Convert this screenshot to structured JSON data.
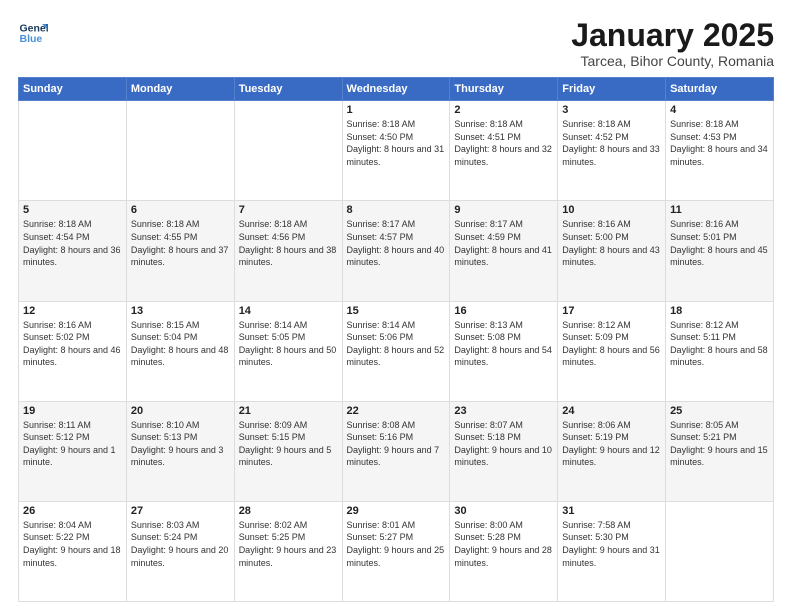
{
  "header": {
    "logo_line1": "General",
    "logo_line2": "Blue",
    "title": "January 2025",
    "subtitle": "Tarcea, Bihor County, Romania"
  },
  "days_of_week": [
    "Sunday",
    "Monday",
    "Tuesday",
    "Wednesday",
    "Thursday",
    "Friday",
    "Saturday"
  ],
  "weeks": [
    [
      {
        "num": "",
        "info": ""
      },
      {
        "num": "",
        "info": ""
      },
      {
        "num": "",
        "info": ""
      },
      {
        "num": "1",
        "info": "Sunrise: 8:18 AM\nSunset: 4:50 PM\nDaylight: 8 hours\nand 31 minutes."
      },
      {
        "num": "2",
        "info": "Sunrise: 8:18 AM\nSunset: 4:51 PM\nDaylight: 8 hours\nand 32 minutes."
      },
      {
        "num": "3",
        "info": "Sunrise: 8:18 AM\nSunset: 4:52 PM\nDaylight: 8 hours\nand 33 minutes."
      },
      {
        "num": "4",
        "info": "Sunrise: 8:18 AM\nSunset: 4:53 PM\nDaylight: 8 hours\nand 34 minutes."
      }
    ],
    [
      {
        "num": "5",
        "info": "Sunrise: 8:18 AM\nSunset: 4:54 PM\nDaylight: 8 hours\nand 36 minutes."
      },
      {
        "num": "6",
        "info": "Sunrise: 8:18 AM\nSunset: 4:55 PM\nDaylight: 8 hours\nand 37 minutes."
      },
      {
        "num": "7",
        "info": "Sunrise: 8:18 AM\nSunset: 4:56 PM\nDaylight: 8 hours\nand 38 minutes."
      },
      {
        "num": "8",
        "info": "Sunrise: 8:17 AM\nSunset: 4:57 PM\nDaylight: 8 hours\nand 40 minutes."
      },
      {
        "num": "9",
        "info": "Sunrise: 8:17 AM\nSunset: 4:59 PM\nDaylight: 8 hours\nand 41 minutes."
      },
      {
        "num": "10",
        "info": "Sunrise: 8:16 AM\nSunset: 5:00 PM\nDaylight: 8 hours\nand 43 minutes."
      },
      {
        "num": "11",
        "info": "Sunrise: 8:16 AM\nSunset: 5:01 PM\nDaylight: 8 hours\nand 45 minutes."
      }
    ],
    [
      {
        "num": "12",
        "info": "Sunrise: 8:16 AM\nSunset: 5:02 PM\nDaylight: 8 hours\nand 46 minutes."
      },
      {
        "num": "13",
        "info": "Sunrise: 8:15 AM\nSunset: 5:04 PM\nDaylight: 8 hours\nand 48 minutes."
      },
      {
        "num": "14",
        "info": "Sunrise: 8:14 AM\nSunset: 5:05 PM\nDaylight: 8 hours\nand 50 minutes."
      },
      {
        "num": "15",
        "info": "Sunrise: 8:14 AM\nSunset: 5:06 PM\nDaylight: 8 hours\nand 52 minutes."
      },
      {
        "num": "16",
        "info": "Sunrise: 8:13 AM\nSunset: 5:08 PM\nDaylight: 8 hours\nand 54 minutes."
      },
      {
        "num": "17",
        "info": "Sunrise: 8:12 AM\nSunset: 5:09 PM\nDaylight: 8 hours\nand 56 minutes."
      },
      {
        "num": "18",
        "info": "Sunrise: 8:12 AM\nSunset: 5:11 PM\nDaylight: 8 hours\nand 58 minutes."
      }
    ],
    [
      {
        "num": "19",
        "info": "Sunrise: 8:11 AM\nSunset: 5:12 PM\nDaylight: 9 hours\nand 1 minute."
      },
      {
        "num": "20",
        "info": "Sunrise: 8:10 AM\nSunset: 5:13 PM\nDaylight: 9 hours\nand 3 minutes."
      },
      {
        "num": "21",
        "info": "Sunrise: 8:09 AM\nSunset: 5:15 PM\nDaylight: 9 hours\nand 5 minutes."
      },
      {
        "num": "22",
        "info": "Sunrise: 8:08 AM\nSunset: 5:16 PM\nDaylight: 9 hours\nand 7 minutes."
      },
      {
        "num": "23",
        "info": "Sunrise: 8:07 AM\nSunset: 5:18 PM\nDaylight: 9 hours\nand 10 minutes."
      },
      {
        "num": "24",
        "info": "Sunrise: 8:06 AM\nSunset: 5:19 PM\nDaylight: 9 hours\nand 12 minutes."
      },
      {
        "num": "25",
        "info": "Sunrise: 8:05 AM\nSunset: 5:21 PM\nDaylight: 9 hours\nand 15 minutes."
      }
    ],
    [
      {
        "num": "26",
        "info": "Sunrise: 8:04 AM\nSunset: 5:22 PM\nDaylight: 9 hours\nand 18 minutes."
      },
      {
        "num": "27",
        "info": "Sunrise: 8:03 AM\nSunset: 5:24 PM\nDaylight: 9 hours\nand 20 minutes."
      },
      {
        "num": "28",
        "info": "Sunrise: 8:02 AM\nSunset: 5:25 PM\nDaylight: 9 hours\nand 23 minutes."
      },
      {
        "num": "29",
        "info": "Sunrise: 8:01 AM\nSunset: 5:27 PM\nDaylight: 9 hours\nand 25 minutes."
      },
      {
        "num": "30",
        "info": "Sunrise: 8:00 AM\nSunset: 5:28 PM\nDaylight: 9 hours\nand 28 minutes."
      },
      {
        "num": "31",
        "info": "Sunrise: 7:58 AM\nSunset: 5:30 PM\nDaylight: 9 hours\nand 31 minutes."
      },
      {
        "num": "",
        "info": ""
      }
    ]
  ]
}
